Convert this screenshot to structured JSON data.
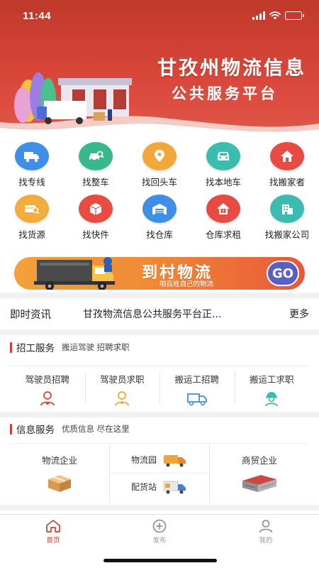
{
  "status_bar": {
    "time": "11:44"
  },
  "hero": {
    "title": "甘孜州物流信息",
    "subtitle": "公共服务平台"
  },
  "quick_grid": [
    {
      "label": "找专线",
      "icon": "truck-icon",
      "color": "#3f8fe6"
    },
    {
      "label": "找整车",
      "icon": "car-search-icon",
      "color": "#37b98c"
    },
    {
      "label": "找回头车",
      "icon": "location-pin-icon",
      "color": "#f1a83a"
    },
    {
      "label": "找本地车",
      "icon": "car-front-icon",
      "color": "#3bbcae"
    },
    {
      "label": "找搬家者",
      "icon": "house-icon",
      "color": "#e84b41"
    },
    {
      "label": "找货源",
      "icon": "cargo-search-icon",
      "color": "#f3ac3b"
    },
    {
      "label": "找快件",
      "icon": "package-icon",
      "color": "#e84b41"
    },
    {
      "label": "找仓库",
      "icon": "warehouse-icon",
      "color": "#3f8fe6"
    },
    {
      "label": "仓库求租",
      "icon": "rent-house-icon",
      "color": "#e84b41"
    },
    {
      "label": "找搬家公司",
      "icon": "building-icon",
      "color": "#3bbcae"
    }
  ],
  "banner": {
    "title": "到村物流",
    "subtitle": "咱百姓自己的物流",
    "go_label": "GO"
  },
  "news": {
    "label": "即时资讯",
    "text": "甘孜物流信息公共服务平台正...",
    "more_label": "更多"
  },
  "recruit": {
    "title": "招工服务",
    "subtitle": "搬运驾驶 招聘求职",
    "items": [
      {
        "label": "驾驶员招聘",
        "icon": "driver-hire-icon",
        "color": "#e0463b"
      },
      {
        "label": "驾驶员求职",
        "icon": "driver-job-icon",
        "color": "#f2a33a"
      },
      {
        "label": "搬运工招聘",
        "icon": "mover-truck-icon",
        "color": "#3f8fe6"
      },
      {
        "label": "搬运工求职",
        "icon": "worker-helmet-icon",
        "color": "#3bbcae"
      }
    ]
  },
  "info": {
    "title": "信息服务",
    "subtitle": "优质信息 尽在这里",
    "logistics_company": "物流企业",
    "logistics_park": "物流园",
    "distribution_station": "配货站",
    "trade_company": "商贸企业"
  },
  "tabbar": {
    "items": [
      {
        "label": "首页",
        "icon": "home-icon"
      },
      {
        "label": "发布",
        "icon": "plus-circle-icon"
      },
      {
        "label": "我的",
        "icon": "user-icon"
      }
    ]
  }
}
